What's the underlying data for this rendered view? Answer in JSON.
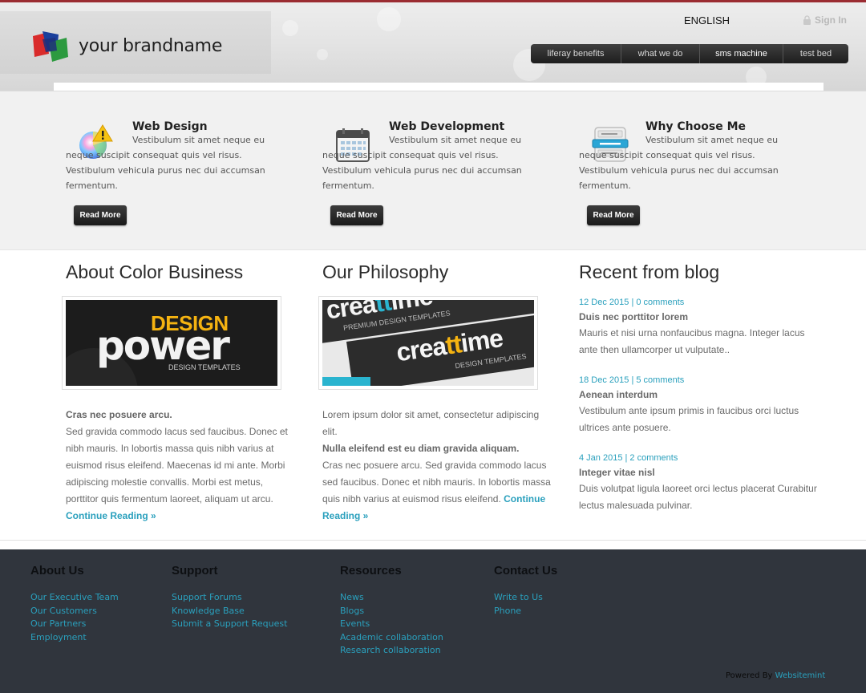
{
  "header": {
    "brand_name": "your brandname",
    "language": "ENGLISH",
    "sign_in": "Sign In",
    "nav": [
      {
        "label": "liferay benefits"
      },
      {
        "label": "what we do"
      },
      {
        "label": "sms machine",
        "active": true
      },
      {
        "label": "test bed"
      }
    ]
  },
  "features": [
    {
      "icon": "color-palette-warning-icon",
      "title": "Web Design",
      "text": "Vestibulum sit amet neque eu neque suscipit consequat quis vel risus. Vestibulum vehicula purus nec dui accumsan fermentum.",
      "button": "Read More"
    },
    {
      "icon": "calendar-icon",
      "title": "Web Development",
      "text": "Vestibulum sit amet neque eu neque suscipit consequat quis vel risus. Vestibulum vehicula purus nec dui accumsan fermentum.",
      "button": "Read More"
    },
    {
      "icon": "menu-list-icon",
      "title": "Why Choose Me",
      "text": "Vestibulum sit amet neque eu neque suscipit consequat quis vel risus. Vestibulum vehicula purus nec dui accumsan fermentum.",
      "button": "Read More"
    }
  ],
  "about": {
    "title": "About Color Business",
    "image_line1": "DESIGN",
    "image_line2": "power",
    "image_line3": "DESIGN TEMPLATES",
    "lead": "Cras nec posuere arcu.",
    "text": "Sed gravida commodo lacus sed faucibus. Donec et nibh mauris. In lobortis massa quis nibh varius at euismod risus eleifend. Maecenas id mi ante. Morbi adipiscing molestie convallis. Morbi est metus, porttitor quis fermentum laoreet, aliquam ut arcu.",
    "link": "Continue Reading »"
  },
  "philosophy": {
    "title": "Our Philosophy",
    "image_brand": "creattime",
    "image_brand_pre": "crea",
    "image_brand_mid": "tt",
    "image_brand_post": "ime",
    "image_sub": "PREMIUM DESIGN TEMPLATES",
    "image_sub2": "DESIGN TEMPLATES",
    "intro": "Lorem ipsum dolor sit amet, consectetur adipiscing elit.",
    "lead": "Nulla eleifend est eu diam gravida aliquam.",
    "text": "Cras nec posuere arcu. Sed gravida commodo lacus sed faucibus. Donec et nibh mauris. In lobortis massa quis nibh varius at euismod risus eleifend.",
    "link": "Continue Reading »"
  },
  "blog": {
    "title": "Recent from blog",
    "posts": [
      {
        "date": "12 Dec 2015",
        "comments": "0 comments",
        "title": "Duis nec porttitor lorem",
        "text": "Mauris et nisi urna nonfaucibus magna. Integer lacus ante then ullamcorper ut vulputate.."
      },
      {
        "date": "18 Dec 2015",
        "comments": "5 comments",
        "title": "Aenean interdum",
        "text": "Vestibulum ante ipsum primis in faucibus orci luctus ultrices ante posuere."
      },
      {
        "date": "4 Jan 2015",
        "comments": "2 comments",
        "title": "Integer vitae nisl",
        "text": "Duis volutpat ligula laoreet orci lectus placerat Curabitur lectus malesuada pulvinar."
      }
    ]
  },
  "footer": {
    "columns": [
      {
        "title": "About Us",
        "links": [
          "Our Executive Team",
          "Our Customers",
          "Our Partners",
          "Employment"
        ]
      },
      {
        "title": "Support",
        "links": [
          "Support Forums",
          "Knowledge Base",
          "Submit a Support Request"
        ]
      },
      {
        "title": "Resources",
        "links": [
          "News",
          "Blogs",
          "Events",
          "Academic collaboration",
          "Research collaboration"
        ]
      },
      {
        "title": "Contact Us",
        "links": [
          "Write to Us",
          "Phone"
        ]
      }
    ],
    "powered_by_label": "Powered By",
    "powered_by_link": "Websitemint"
  },
  "colors": {
    "accent": "#2aa0bd",
    "header_top_border": "#9b2c32",
    "footer_bg": "#30353d"
  }
}
